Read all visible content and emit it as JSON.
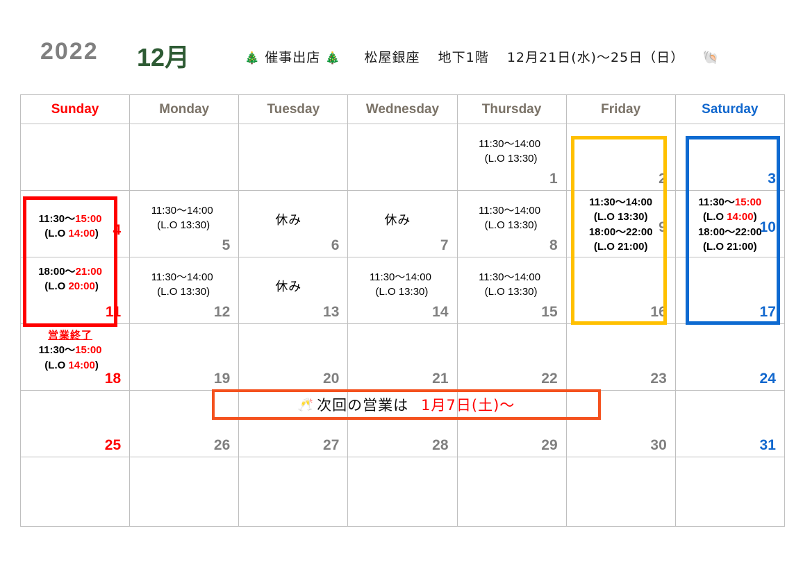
{
  "header": {
    "year": "2022",
    "month": "12月",
    "note_tree_left": "🎄",
    "note_event": "催事出店",
    "note_tree_right": "🎄",
    "note_venue": "松屋銀座",
    "note_floor": "地下1階",
    "note_dates": "12月21日(水)〜25日（日）",
    "note_shell": "🐚"
  },
  "weekdays": [
    {
      "label": "Sunday",
      "color": "#ff0000"
    },
    {
      "label": "Monday",
      "color": "#7b7368"
    },
    {
      "label": "Tuesday",
      "color": "#7b7368"
    },
    {
      "label": "Wednesday",
      "color": "#7b7368"
    },
    {
      "label": "Thursday",
      "color": "#7b7368"
    },
    {
      "label": "Friday",
      "color": "#7b7368"
    },
    {
      "label": "Saturday",
      "color": "#1268ce"
    }
  ],
  "colors": {
    "sunday_red": "#ff0000",
    "saturday_blue": "#1268ce",
    "weekday_gray": "#808080",
    "highlight_red": "#ff0000",
    "highlight_yellow": "#ffc000",
    "highlight_blue": "#0d6ad1",
    "banner_orange": "#f4511e",
    "month_green": "#2e5b34",
    "year_gray": "#808080",
    "grid_line": "#bfbfbf"
  },
  "days": {
    "d1": {
      "num": "1",
      "lunch_open": "11:30〜14:00",
      "lunch_lo": "(L.O 13:30)"
    },
    "d2": {
      "num": "2"
    },
    "d3": {
      "num": "3"
    },
    "d4": {
      "num": "4",
      "lunch_pre": "11:30〜",
      "lunch_end": "15:00",
      "lo_pre": "(L.O ",
      "lo_end": "14:00",
      "lo_post": ")"
    },
    "d5": {
      "num": "5",
      "lunch_open": "11:30〜14:00",
      "lunch_lo": "(L.O 13:30)"
    },
    "d6": {
      "num": "6",
      "closed": "休み"
    },
    "d7": {
      "num": "7",
      "closed": "休み"
    },
    "d8": {
      "num": "8",
      "lunch_open": "11:30〜14:00",
      "lunch_lo": "(L.O 13:30)"
    },
    "d9": {
      "num": "9",
      "lunch_open": "11:30〜14:00",
      "lunch_lo": "(L.O 13:30)",
      "dinner_open": "18:00〜22:00",
      "dinner_lo": "(L.O 21:00)"
    },
    "d10": {
      "num": "10",
      "lunch_pre": "11:30〜",
      "lunch_end": "15:00",
      "lo_pre": "(L.O ",
      "lo_end": "14:00",
      "lo_post": ")",
      "dinner_open": "18:00〜22:00",
      "dinner_lo": "(L.O 21:00)"
    },
    "d11": {
      "num": "11",
      "dinner_pre": "18:00〜",
      "dinner_end": "21:00",
      "lo_pre": "(L.O ",
      "lo_end": "20:00",
      "lo_post": ")"
    },
    "d12": {
      "num": "12",
      "lunch_open": "11:30〜14:00",
      "lunch_lo": "(L.O 13:30)"
    },
    "d13": {
      "num": "13",
      "closed": "休み"
    },
    "d14": {
      "num": "14",
      "lunch_open": "11:30〜14:00",
      "lunch_lo": "(L.O 13:30)"
    },
    "d15": {
      "num": "15",
      "lunch_open": "11:30〜14:00",
      "lunch_lo": "(L.O 13:30)"
    },
    "d16": {
      "num": "16"
    },
    "d17": {
      "num": "17"
    },
    "d18": {
      "num": "18",
      "end_label": "営業終了",
      "lunch_pre": "11:30〜",
      "lunch_end": "15:00",
      "lo_pre": "(L.O ",
      "lo_end": "14:00",
      "lo_post": ")"
    },
    "d19": {
      "num": "19"
    },
    "d20": {
      "num": "20"
    },
    "d21": {
      "num": "21"
    },
    "d22": {
      "num": "22"
    },
    "d23": {
      "num": "23"
    },
    "d24": {
      "num": "24"
    },
    "d25": {
      "num": "25"
    },
    "d26": {
      "num": "26"
    },
    "d27": {
      "num": "27"
    },
    "d28": {
      "num": "28"
    },
    "d29": {
      "num": "29"
    },
    "d30": {
      "num": "30"
    },
    "d31": {
      "num": "31"
    }
  },
  "banner": {
    "glass_icon": "🥂",
    "text": "次回の営業は",
    "next_date": "1月7日(土)〜"
  }
}
